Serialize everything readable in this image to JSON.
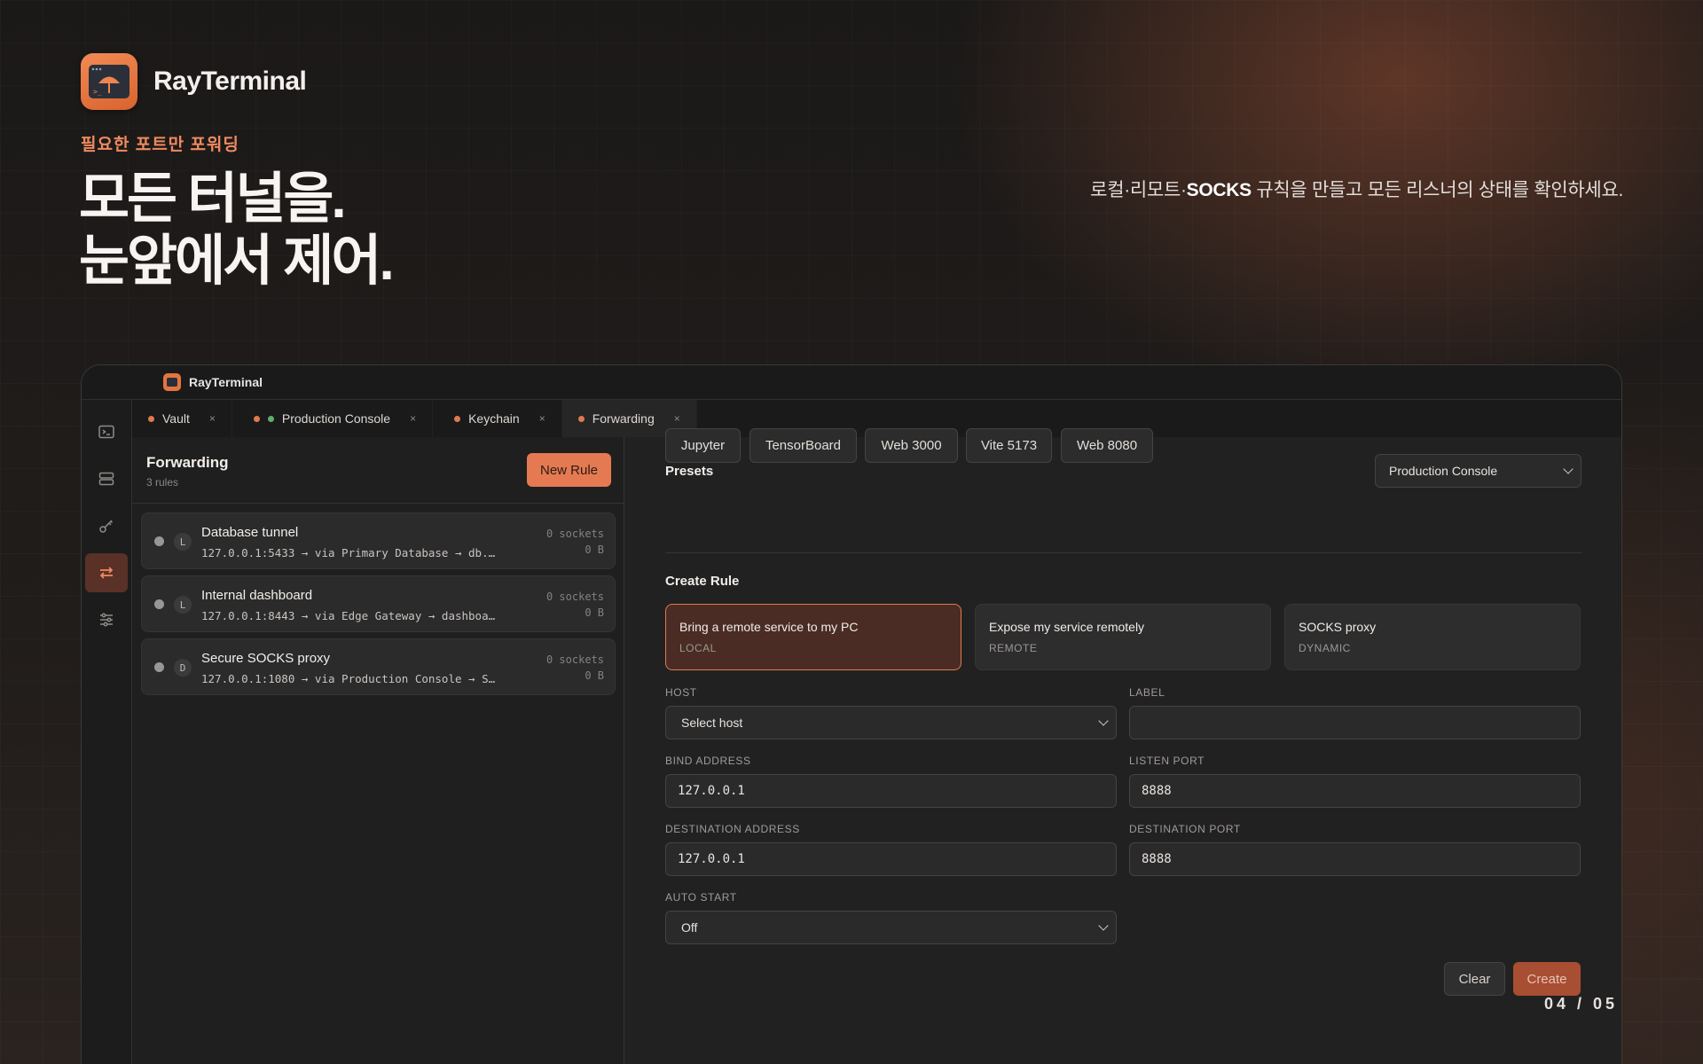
{
  "brand": {
    "name": "RayTerminal"
  },
  "hero": {
    "eyebrow": "필요한 포트만 포워딩",
    "headline_line1": "모든 터널을.",
    "headline_line2": "눈앞에서 제어.",
    "tagline_prefix": "로컬·리모트·",
    "tagline_bold": "SOCKS",
    "tagline_suffix": " 규칙을 만들고 모든 리스너의 상태를 확인하세요."
  },
  "app": {
    "title": "RayTerminal",
    "rail_icons": [
      "terminal-icon",
      "servers-icon",
      "key-icon",
      "forwarding-icon",
      "settings-sliders-icon"
    ],
    "tabs": [
      {
        "label": "Vault",
        "close": "×"
      },
      {
        "label": "Production Console",
        "close": "×"
      },
      {
        "label": "Keychain",
        "close": "×"
      },
      {
        "label": "Forwarding",
        "close": "×"
      }
    ],
    "list": {
      "title": "Forwarding",
      "subtitle": "3 rules",
      "new_button": "New Rule",
      "rules": [
        {
          "type": "L",
          "name": "Database tunnel",
          "path": "127.0.0.1:5433 → via Primary Database → db.…",
          "sockets": "0 sockets",
          "bytes": "0 B"
        },
        {
          "type": "L",
          "name": "Internal dashboard",
          "path": "127.0.0.1:8443 → via Edge Gateway → dashboa…",
          "sockets": "0 sockets",
          "bytes": "0 B"
        },
        {
          "type": "D",
          "name": "Secure SOCKS proxy",
          "path": "127.0.0.1:1080 → via Production Console → S…",
          "sockets": "0 sockets",
          "bytes": "0 B"
        }
      ]
    },
    "form": {
      "presets_title": "Presets",
      "host_scope": "Production Console",
      "presets": [
        "Jupyter",
        "TensorBoard",
        "Web 3000",
        "Vite 5173",
        "Web 8080"
      ],
      "create_title": "Create Rule",
      "modes": [
        {
          "title": "Bring a remote service to my PC",
          "sub": "LOCAL"
        },
        {
          "title": "Expose my service remotely",
          "sub": "REMOTE"
        },
        {
          "title": "SOCKS proxy",
          "sub": "DYNAMIC"
        }
      ],
      "host_label": "HOST",
      "host_value": "Select host",
      "label_label": "LABEL",
      "label_value": "",
      "bind_label": "BIND ADDRESS",
      "bind_value": "127.0.0.1",
      "listen_label": "LISTEN PORT",
      "listen_value": "8888",
      "dest_addr_label": "DESTINATION ADDRESS",
      "dest_addr_value": "127.0.0.1",
      "dest_port_label": "DESTINATION PORT",
      "dest_port_value": "8888",
      "autostart_label": "AUTO START",
      "autostart_value": "Off",
      "clear_button": "Clear",
      "create_button": "Create"
    }
  },
  "pager": "04 / 05",
  "colors": {
    "accent": "#e57a52",
    "active_dot": "#e07a4f",
    "online_dot": "#5fae6e"
  }
}
